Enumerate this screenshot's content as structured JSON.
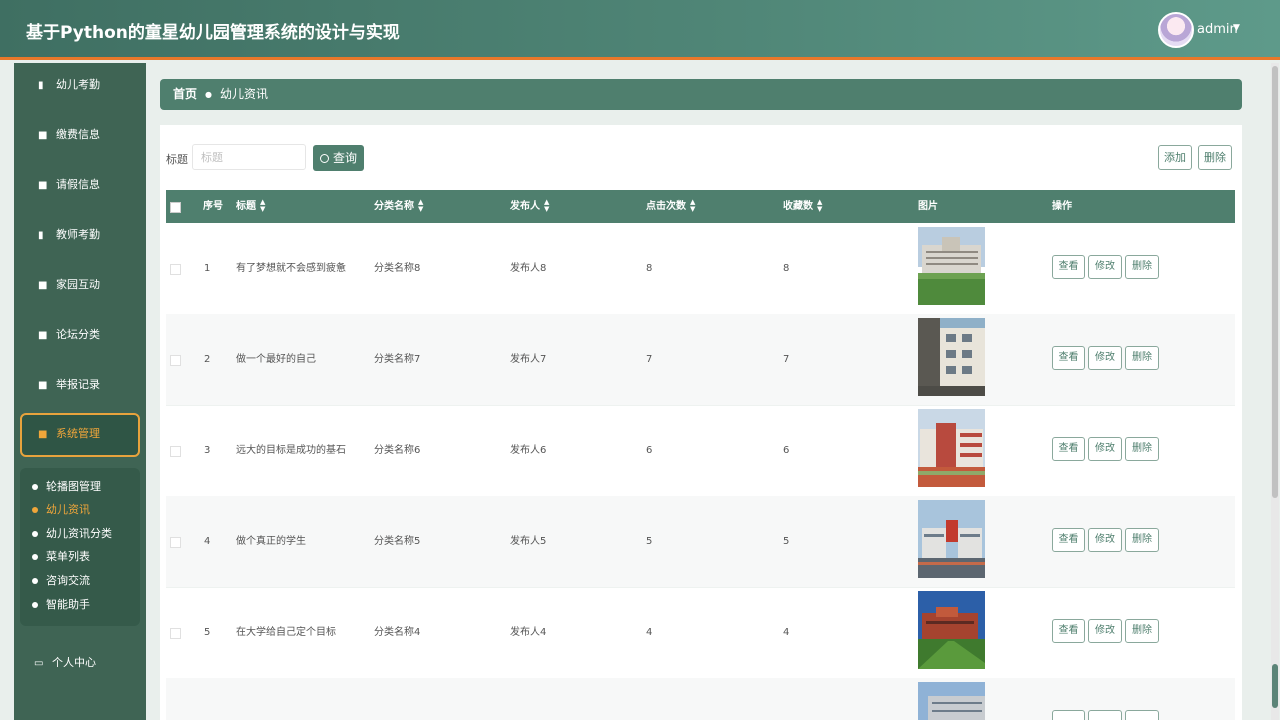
{
  "header": {
    "title": "基于Python的童星幼儿园管理系统的设计与实现",
    "user": "admin"
  },
  "sidebar": {
    "items": [
      {
        "label": "幼儿考勤",
        "icon": "book-icon"
      },
      {
        "label": "缴费信息",
        "icon": "grid-icon"
      },
      {
        "label": "请假信息",
        "icon": "grid-icon"
      },
      {
        "label": "教师考勤",
        "icon": "book-icon"
      },
      {
        "label": "家园互动",
        "icon": "grid-icon"
      },
      {
        "label": "论坛分类",
        "icon": "grid-icon"
      },
      {
        "label": "举报记录",
        "icon": "grid-icon"
      },
      {
        "label": "系统管理",
        "icon": "grid-icon"
      }
    ],
    "submenu": [
      "轮播图管理",
      "幼儿资讯",
      "幼儿资讯分类",
      "菜单列表",
      "咨询交流",
      "智能助手"
    ],
    "personal": "个人中心"
  },
  "breadcrumb": {
    "home": "首页",
    "current": "幼儿资讯"
  },
  "search": {
    "label": "标题",
    "placeholder": "标题",
    "button": "查询"
  },
  "toolbar": {
    "add": "添加",
    "delete": "删除"
  },
  "table": {
    "headers": [
      "序号",
      "标题",
      "分类名称",
      "发布人",
      "点击次数",
      "收藏数",
      "图片",
      "操作"
    ],
    "rows": [
      {
        "no": "1",
        "title": "有了梦想就不会感到疲惫",
        "category": "分类名称8",
        "publisher": "发布人8",
        "clicks": "8",
        "favorites": "8"
      },
      {
        "no": "2",
        "title": "做一个最好的自己",
        "category": "分类名称7",
        "publisher": "发布人7",
        "clicks": "7",
        "favorites": "7"
      },
      {
        "no": "3",
        "title": "远大的目标是成功的基石",
        "category": "分类名称6",
        "publisher": "发布人6",
        "clicks": "6",
        "favorites": "6"
      },
      {
        "no": "4",
        "title": "做个真正的学生",
        "category": "分类名称5",
        "publisher": "发布人5",
        "clicks": "5",
        "favorites": "5"
      },
      {
        "no": "5",
        "title": "在大学给自己定个目标",
        "category": "分类名称4",
        "publisher": "发布人4",
        "clicks": "4",
        "favorites": "4"
      }
    ],
    "actions": {
      "view": "查看",
      "edit": "修改",
      "delete": "删除"
    }
  }
}
